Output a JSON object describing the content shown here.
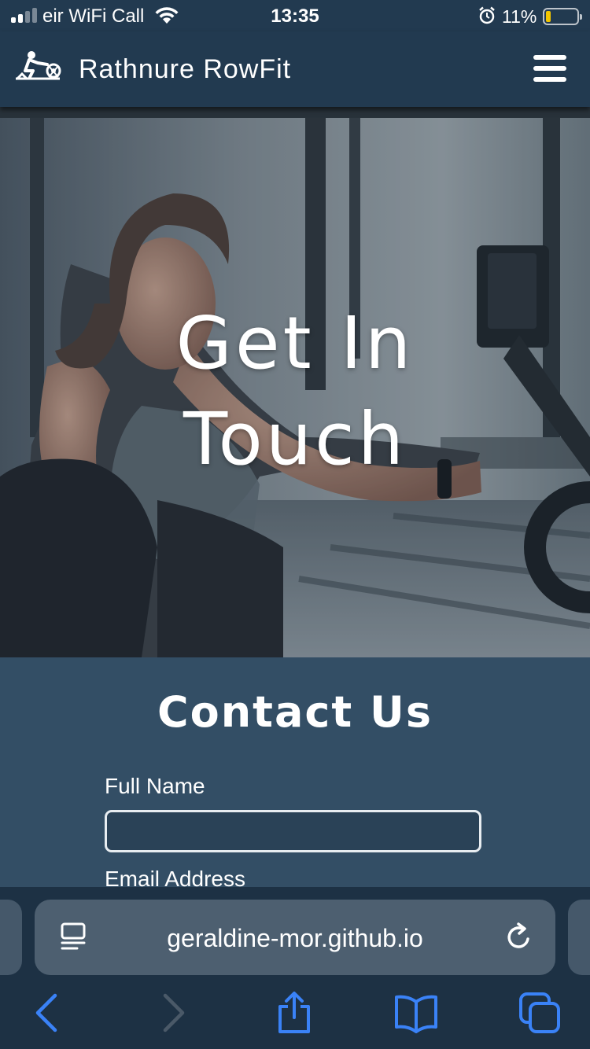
{
  "status_bar": {
    "carrier": "eir WiFi Call",
    "time": "13:35",
    "battery_percent": "11%",
    "battery_level": 0.11,
    "signal_bars": 2,
    "icons": [
      "signal-icon",
      "wifi-icon",
      "alarm-icon",
      "battery-icon"
    ]
  },
  "navbar": {
    "brand_name": "Rathnure RowFit",
    "logo_icon": "rowing-machine-icon",
    "menu_icon": "hamburger-icon"
  },
  "hero": {
    "title_line1": "Get In",
    "title_line2": "Touch",
    "image": "woman-on-rowing-machine-photo"
  },
  "contact": {
    "heading": "Contact Us",
    "full_name_label": "Full Name",
    "full_name_value": "",
    "email_label": "Email Address"
  },
  "browser": {
    "url": "geraldine-mor.github.io",
    "toolbar_icons": [
      "back-icon",
      "forward-icon",
      "share-icon",
      "bookmarks-icon",
      "tabs-icon"
    ],
    "accent_color": "#3a82f7",
    "forward_enabled": false
  },
  "colors": {
    "navbar": "#223a50",
    "contact_bg": "#334e65",
    "text": "#ffffff",
    "battery_low": "#f2c500"
  }
}
